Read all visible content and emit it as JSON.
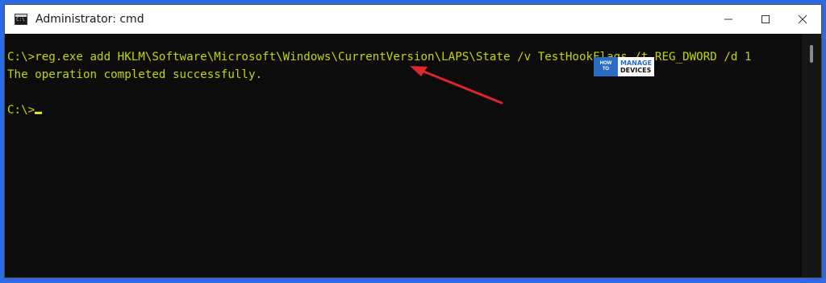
{
  "window": {
    "title": "Administrator: cmd",
    "icon": "cmd-icon",
    "controls": [
      "minimize-icon",
      "maximize-icon",
      "close-icon"
    ]
  },
  "console": {
    "lines": [
      "C:\\>reg.exe add HKLM\\Software\\Microsoft\\Windows\\CurrentVersion\\LAPS\\State /v TestHookFlags /t REG_DWORD /d 1",
      "The operation completed successfully.",
      "",
      "C:\\>"
    ],
    "text_color": "#c4d600",
    "background": "#0c0c0c"
  },
  "watermark": {
    "how": "HOW",
    "to": "TO",
    "manage": "MANAGE",
    "devices": "DEVICES"
  },
  "annotation": {
    "arrow_color": "#e0252b"
  }
}
